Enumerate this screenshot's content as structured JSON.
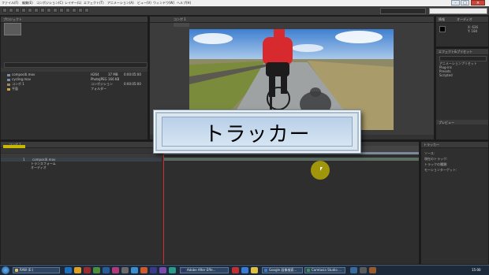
{
  "menu": {
    "items": [
      "ファイル(F)",
      "編集(E)",
      "コンポジション(C)",
      "レイヤー(L)",
      "エフェクト(T)",
      "アニメーション(A)",
      "ビュー(V)",
      "ウィンドウ(W)",
      "ヘルプ(H)"
    ]
  },
  "project": {
    "tab_label": "プロジェクト",
    "files": [
      {
        "name": "compositi.mov",
        "type": "H264",
        "size": "37 MB",
        "duration": "0:00:05:00"
      },
      {
        "name": "cycling.mov",
        "type": "PhotoJPEG",
        "size": "166 KB",
        "duration": ""
      },
      {
        "name": "コンポ 1",
        "type": "コンポジション",
        "size": "",
        "duration": "0:00:05:00"
      },
      {
        "name": "平面",
        "type": "フォルダー",
        "size": "",
        "duration": ""
      }
    ]
  },
  "composition": {
    "tab_label": "コンポ 1"
  },
  "banner": {
    "text": "トラッカー"
  },
  "info_panel": {
    "tab_label": "情報",
    "tab2_label": "オーディオ",
    "x": "X: 636",
    "y": "Y: 184"
  },
  "effects_panel": {
    "tab_label": "エフェクト&プリセット",
    "items": [
      "アニメーションプリセット",
      "Plug-ins",
      "Presets",
      "Scripted"
    ]
  },
  "timeline": {
    "tab_label": "コンポ 1",
    "layers": [
      {
        "index": "1",
        "name": "compositi.mov"
      },
      {
        "index": "",
        "name": "トランスフォーム"
      },
      {
        "index": "",
        "name": "オーディオ"
      }
    ]
  },
  "tracker_panel": {
    "tab_label": "トラッカー",
    "fields": [
      "ソース:",
      "現在のトラック:",
      "トラックの種類:",
      "モーションターゲット:"
    ]
  },
  "preview_panel": {
    "tab_label": "プレビュー"
  },
  "taskbar": {
    "tasks": [
      {
        "label": "RAW (E:)",
        "color": "#e3c25a"
      },
      {
        "label": "Adobe After Effe...",
        "color": "#3b2b6b"
      },
      {
        "label": "Google 画像検索...",
        "color": "#3a7bd5"
      },
      {
        "label": "Camtasia Studio ...",
        "color": "#3a9a4a"
      }
    ],
    "clock": "15:00"
  },
  "colors": {
    "accent_yellow": "#c8b800",
    "timeline_red": "#d23030",
    "banner_bg": "#d9e5ef"
  }
}
